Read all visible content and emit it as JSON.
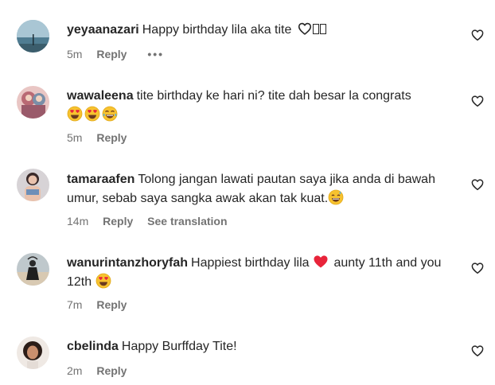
{
  "comments": [
    {
      "username": "yeyaanazari",
      "text": "Happy birthday lila aka tite",
      "time": "5m",
      "reply_label": "Reply",
      "more_label": "•••",
      "trailing_icons": [
        "heart-outline-icon",
        "missing-glyph-icon",
        "missing-glyph-icon"
      ]
    },
    {
      "username": "wawaleena",
      "text": "tite birthday ke hari ni? tite dah besar la congrats",
      "time": "5m",
      "reply_label": "Reply",
      "emojis": [
        "heart-eyes-emoji",
        "heart-eyes-emoji",
        "tears-of-joy-emoji"
      ]
    },
    {
      "username": "tamaraafen",
      "text": "Tolong jangan lawati pautan saya jika anda di bawah umur, sebab saya sangka awak akan tak kuat.",
      "time": "14m",
      "reply_label": "Reply",
      "translation_label": "See translation",
      "emojis": [
        "grinning-sweat-emoji"
      ]
    },
    {
      "username": "wanurintanzhoryfah",
      "text_before": "Happiest birthday lila",
      "text_after": "aunty 11th and you 12th",
      "time": "7m",
      "reply_label": "Reply",
      "emojis": [
        "red-heart-emoji",
        "heart-eyes-emoji"
      ]
    },
    {
      "username": "cbelinda",
      "text": "Happy Burffday Tite!",
      "time": "2m",
      "reply_label": "Reply"
    }
  ],
  "colors": {
    "text": "#262626",
    "muted": "#737373",
    "background": "#ffffff"
  }
}
